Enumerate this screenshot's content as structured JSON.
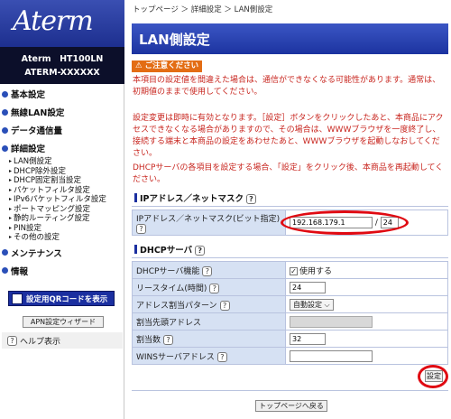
{
  "brand": {
    "logo": "Aterm",
    "model_line1": "Aterm　HT100LN",
    "model_line2": "ATERM-XXXXXX"
  },
  "nav": {
    "basic": "基本設定",
    "wireless": "無線LAN設定",
    "data": "データ通信量",
    "detail": "詳細設定",
    "sub": [
      "LAN側設定",
      "DHCP除外設定",
      "DHCP固定割当設定",
      "パケットフィルタ設定",
      "IPv6パケットフィルタ設定",
      "ポートマッピング設定",
      "静的ルーティング設定",
      "PIN設定",
      "その他の設定"
    ],
    "maintenance": "メンテナンス",
    "info": "情報",
    "qr_button": "設定用QRコードを表示",
    "apn_button": "APN設定ウィザード",
    "help": "ヘルプ表示"
  },
  "breadcrumb": "トップページ ＞ 詳細設定 ＞ LAN側設定",
  "page_title": "LAN側設定",
  "caution_label": "ご注意ください",
  "messages": {
    "m1": "本項目の設定値を間違えた場合は、通信ができなくなる可能性があります。通常は、初期値のままで使用してください。",
    "m2": "設定変更は即時に有効となります。［設定］ボタンをクリックしたあと、本商品にアクセスできなくなる場合がありますので、その場合は、WWWブラウザを一度終了し、接続する端末と本商品の設定をあわせたあと、WWWブラウザを起動しなおしてください。",
    "m3": "DHCPサーバの各項目を設定する場合、「設定」をクリック後、本商品を再起動してください。"
  },
  "ip_section": {
    "title": "IPアドレス／ネットマスク",
    "row_label": "IPアドレス／ネットマスク(ビット指定)",
    "ip_value": "192.168.179.1",
    "separator": "/",
    "mask_value": "24"
  },
  "dhcp_section": {
    "title": "DHCPサーバ",
    "rows": {
      "func": {
        "label": "DHCPサーバ機能",
        "value": "使用する"
      },
      "lease": {
        "label": "リースタイム(時間)",
        "value": "24"
      },
      "pattern": {
        "label": "アドレス割当パターン",
        "value": "自動設定"
      },
      "start": {
        "label": "割当先頭アドレス",
        "value": ""
      },
      "count": {
        "label": "割当数",
        "value": "32"
      },
      "wins": {
        "label": "WINSサーバアドレス",
        "value": ""
      }
    }
  },
  "buttons": {
    "set": "設定",
    "back": "トップページへ戻る"
  },
  "colors": {
    "header_blue": "#1c33a0",
    "caution_orange": "#e36d14",
    "warning_red": "#c8261f",
    "highlight_ring": "#e00a12"
  }
}
